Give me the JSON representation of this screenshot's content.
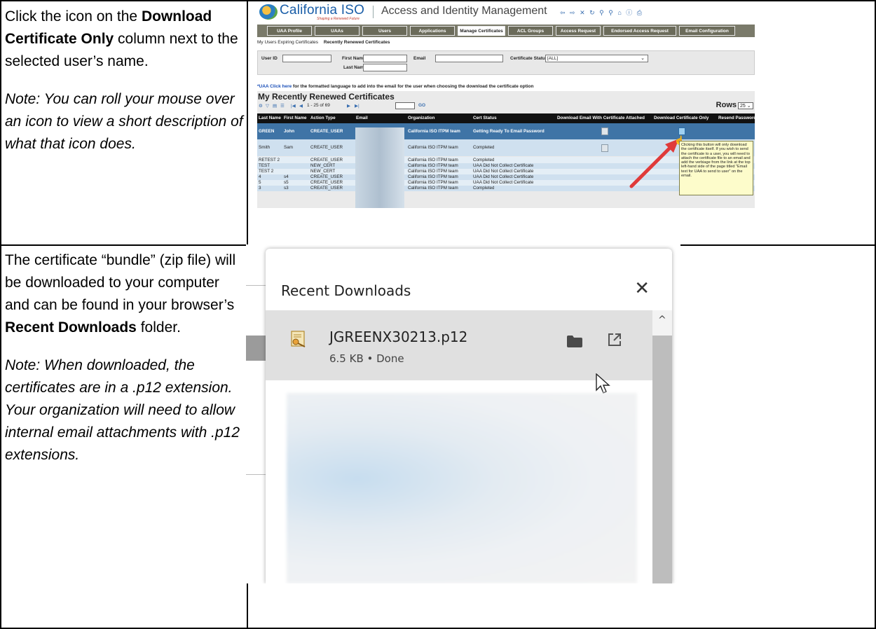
{
  "row1": {
    "instr_pre": "Click the icon on the ",
    "instr_bold": "Download Certificate Only",
    "instr_post": " column next to the selected user’s name.",
    "note": "Note: You can roll your mouse over an icon to view a short description of what that icon does."
  },
  "row2": {
    "instr_pre": "The certificate “bundle” (zip file) will be downloaded to your computer and can be found in your browser’s ",
    "instr_bold": "Recent Downloads",
    "instr_post": " folder.",
    "note": "Note: When downloaded, the certificates are in a .p12 extension. Your organization will need to allow internal email attachments with .p12 extensions."
  },
  "aim": {
    "logo": "California ISO",
    "tagline": "Shaping a Renewed Future",
    "title": "Access and Identity Management",
    "tools": "⇦ ⇨ ✕ ↻ ⚲ ⚲ ⌂ ⓘ ⎙",
    "tabs": [
      "UAA Profile",
      "UAAs",
      "Users",
      "Applications",
      "Manage Certificates",
      "ACL Groups",
      "Access Request",
      "Endorsed Access Request",
      "Email Configuration"
    ],
    "active_tab": "Manage Certificates",
    "subtabs": [
      "My Users Expiring Certificates",
      "Recently Renewed Certificates"
    ],
    "filter": {
      "user_id": "User ID",
      "first_name": "First Name",
      "last_name": "Last Name",
      "email": "Email",
      "cert_status": "Certificate Status",
      "cert_status_value": "[ALL]"
    },
    "note_link": "*UAA Click here",
    "note_text": " for the formatted language to add into the email for the user when choosing the download the certificate option",
    "panel_title": "My Recently Renewed Certificates",
    "pager": {
      "range": "1 - 25 of 69",
      "go": "GO",
      "rows_label": "Rows",
      "rows_value": "25"
    },
    "columns": [
      "Last Name",
      "First Name",
      "Action Type",
      "Email",
      "Organization",
      "Cert Status",
      "Download Email With Certificate Attached",
      "Download Certificate Only",
      "Resend Password"
    ],
    "rows": [
      [
        "GREEN",
        "John",
        "CREATE_USER",
        "California ISO ITPM team",
        "Getting Ready To Email Password"
      ],
      [
        "Smith",
        "Sam",
        "CREATE_USER",
        "California ISO ITPM team",
        "Completed"
      ],
      [
        "RETEST 2",
        "",
        "CREATE_USER",
        "California ISO ITPM team",
        "Completed"
      ],
      [
        "TEST",
        "",
        "NEW_CERT",
        "California ISO ITPM team",
        "UAA Did Not Collect Certificate"
      ],
      [
        "TEST 2",
        "",
        "NEW_CERT",
        "California ISO ITPM team",
        "UAA Did Not Collect Certificate"
      ],
      [
        "4",
        "s4",
        "CREATE_USER",
        "California ISO ITPM team",
        "UAA Did Not Collect Certificate"
      ],
      [
        "5",
        "s5",
        "CREATE_USER",
        "California ISO ITPM team",
        "UAA Did Not Collect Certificate"
      ],
      [
        "3",
        "s3",
        "CREATE_USER",
        "California ISO ITPM team",
        "Completed"
      ]
    ],
    "tooltip": "Clicking this button will only download the certificate itself. If you wish to send the certificate to a user, you will need to attach the certificate file to an email and add the verbiage from the link at the top left-hand side of the page titled \"Email text for UAA to send to user\" on the email."
  },
  "downloads": {
    "title": "Recent Downloads",
    "close": "✕",
    "file_name": "JGREENX30213.p12",
    "file_status": "6.5 KB • Done",
    "scroll_up": "^"
  },
  "colors": {
    "selected_row": "#3f74a6",
    "row": "#cfe0ef",
    "header": "#111111",
    "tab_bar": "#7a7a6a",
    "arrow": "#e03a3a",
    "tooltip_bg": "#fdfccb"
  }
}
